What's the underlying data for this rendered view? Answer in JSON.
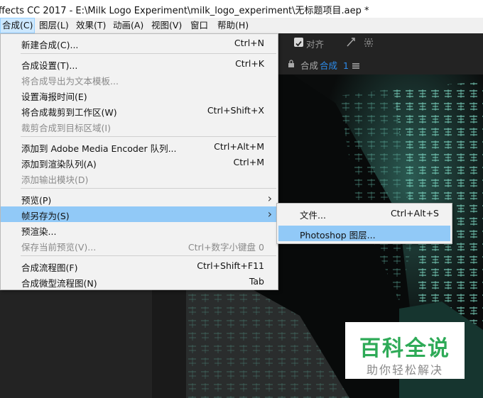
{
  "window": {
    "title": "ffects CC 2017 - E:\\Milk Logo Experiment\\milk_logo_experiment\\无标题项目.aep *"
  },
  "menubar": {
    "items": [
      {
        "label": "合成(C)",
        "active": true
      },
      {
        "label": "图层(L)"
      },
      {
        "label": "效果(T)"
      },
      {
        "label": "动画(A)"
      },
      {
        "label": "视图(V)"
      },
      {
        "label": "窗口"
      },
      {
        "label": "帮助(H)"
      }
    ]
  },
  "toolbar": {
    "align_label": "对齐",
    "align_checked": true
  },
  "comp_tab": {
    "prefix": "合成",
    "name": "合成",
    "number": "1"
  },
  "composition_menu": {
    "items": [
      {
        "label": "新建合成(C)...",
        "shortcut": "Ctrl+N"
      },
      {
        "label": "合成设置(T)...",
        "shortcut": "Ctrl+K"
      },
      {
        "label": "将合成导出为文本模板...",
        "disabled": true
      },
      {
        "label": "设置海报时间(E)"
      },
      {
        "label": "将合成裁剪到工作区(W)",
        "shortcut": "Ctrl+Shift+X"
      },
      {
        "label": "裁剪合成到目标区域(I)",
        "disabled": true
      },
      {
        "label": "添加到 Adobe Media Encoder 队列...",
        "shortcut": "Ctrl+Alt+M"
      },
      {
        "label": "添加到渲染队列(A)",
        "shortcut": "Ctrl+M"
      },
      {
        "label": "添加输出模块(D)",
        "disabled": true
      },
      {
        "label": "预览(P)",
        "submenu": true
      },
      {
        "label": "帧另存为(S)",
        "submenu": true,
        "highlighted": true
      },
      {
        "label": "预渲染..."
      },
      {
        "label": "保存当前预览(V)...",
        "shortcut": "Ctrl+数字小键盘 0",
        "disabled": true
      },
      {
        "label": "合成流程图(F)",
        "shortcut": "Ctrl+Shift+F11"
      },
      {
        "label": "合成微型流程图(N)",
        "shortcut": "Tab"
      }
    ]
  },
  "save_frame_submenu": {
    "items": [
      {
        "label": "文件...",
        "shortcut": "Ctrl+Alt+S"
      },
      {
        "label": "Photoshop 图层...",
        "highlighted": true
      }
    ]
  },
  "watermark": {
    "title": "百科全说",
    "subtitle": "助你轻松解决"
  },
  "colors": {
    "menu_highlight": "#91c9f7",
    "menubar_active": "#cce8ff",
    "watermark_green": "#2eaa57"
  }
}
